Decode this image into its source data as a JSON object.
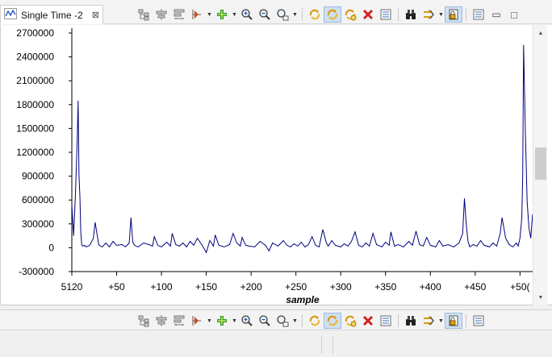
{
  "tab": {
    "title": "Single Time -2",
    "close_glyph": "⊠"
  },
  "window_controls": {
    "minimize": "▭",
    "maximize": "□"
  },
  "toolbar_icons": [
    "tree-icon",
    "align-icon",
    "layout-icon",
    "marker-icon",
    "add-icon",
    "zoom-in-icon",
    "zoom-out-icon",
    "zoom-fit-icon",
    "sync-icon",
    "sync-pressed-icon",
    "sync-alt-icon",
    "delete-icon",
    "properties-icon",
    "binoculars-icon",
    "step-icon",
    "lock-pressed-icon",
    "view-icon"
  ],
  "chart_data": {
    "type": "line",
    "title": "",
    "xlabel": "sample",
    "ylabel": "",
    "xlim": [
      0,
      515
    ],
    "ylim": [
      -300000,
      2700000
    ],
    "y_ticks": [
      -300000,
      0,
      300000,
      600000,
      900000,
      1200000,
      1500000,
      1800000,
      2100000,
      2400000,
      2700000
    ],
    "y_tick_labels": [
      "-300000",
      "0",
      "300000",
      "600000",
      "900000",
      "1200000",
      "1500000",
      "1800000",
      "2100000",
      "2400000",
      "2700000"
    ],
    "x_ticks": [
      0,
      50,
      100,
      150,
      200,
      250,
      300,
      350,
      400,
      450,
      500
    ],
    "x_tick_labels": [
      "5120",
      "+50",
      "+100",
      "+150",
      "+200",
      "+250",
      "+300",
      "+350",
      "+400",
      "+450",
      "+50("
    ],
    "grid": false,
    "series_color": "#00007f",
    "series": [
      {
        "x": [
          0,
          2,
          4,
          6,
          7,
          8,
          9,
          10,
          11,
          12,
          14,
          16,
          20,
          24,
          26,
          28,
          30,
          32,
          34,
          38,
          42,
          46,
          50,
          56,
          60,
          64,
          66,
          68,
          70,
          74,
          80,
          86,
          90,
          92,
          96,
          100,
          106,
          110,
          112,
          116,
          120,
          124,
          128,
          132,
          136,
          140,
          146,
          150,
          154,
          158,
          160,
          164,
          170,
          176,
          180,
          184,
          188,
          190,
          194,
          198,
          204,
          210,
          216,
          220,
          224,
          230,
          236,
          240,
          244,
          248,
          252,
          256,
          260,
          264,
          268,
          272,
          276,
          280,
          284,
          286,
          290,
          294,
          300,
          304,
          308,
          312,
          316,
          320,
          324,
          328,
          332,
          336,
          340,
          346,
          350,
          354,
          356,
          360,
          364,
          370,
          376,
          380,
          384,
          388,
          392,
          396,
          400,
          406,
          410,
          414,
          420,
          426,
          432,
          436,
          438,
          440,
          442,
          444,
          448,
          452,
          456,
          460,
          466,
          470,
          474,
          478,
          480,
          484,
          488,
          492,
          496,
          498,
          500,
          502,
          503,
          504,
          506,
          508,
          510,
          512,
          514
        ],
        "y": [
          540000,
          150000,
          650000,
          1350000,
          1850000,
          900000,
          650000,
          200000,
          40000,
          20000,
          30000,
          10000,
          30000,
          120000,
          320000,
          180000,
          40000,
          20000,
          10000,
          60000,
          10000,
          80000,
          30000,
          40000,
          10000,
          60000,
          380000,
          70000,
          30000,
          10000,
          60000,
          40000,
          20000,
          140000,
          30000,
          10000,
          70000,
          20000,
          180000,
          40000,
          20000,
          60000,
          10000,
          80000,
          30000,
          120000,
          20000,
          -60000,
          90000,
          20000,
          160000,
          30000,
          10000,
          40000,
          180000,
          60000,
          20000,
          130000,
          30000,
          20000,
          10000,
          80000,
          30000,
          -40000,
          60000,
          20000,
          90000,
          30000,
          10000,
          50000,
          20000,
          70000,
          10000,
          40000,
          140000,
          30000,
          10000,
          230000,
          60000,
          20000,
          90000,
          30000,
          10000,
          50000,
          20000,
          80000,
          200000,
          30000,
          10000,
          60000,
          20000,
          180000,
          40000,
          10000,
          70000,
          30000,
          200000,
          20000,
          40000,
          10000,
          80000,
          30000,
          210000,
          40000,
          20000,
          130000,
          30000,
          10000,
          90000,
          20000,
          40000,
          10000,
          60000,
          180000,
          620000,
          300000,
          80000,
          10000,
          40000,
          20000,
          90000,
          30000,
          10000,
          60000,
          20000,
          180000,
          380000,
          120000,
          40000,
          10000,
          60000,
          20000,
          120000,
          380000,
          900000,
          2550000,
          1450000,
          580000,
          250000,
          120000,
          420000
        ]
      }
    ]
  }
}
